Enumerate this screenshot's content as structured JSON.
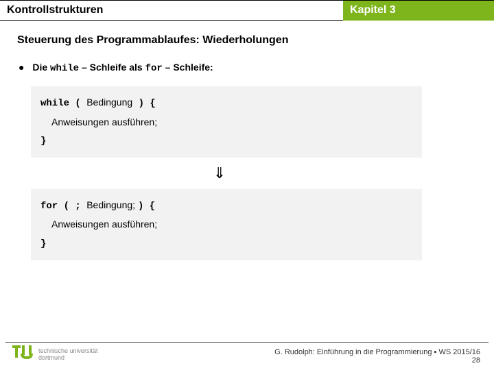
{
  "header": {
    "left": "Kontrollstrukturen",
    "right": "Kapitel 3"
  },
  "subtitle": "Steuerung des Programmablaufes: Wiederholungen",
  "bullet": {
    "pre": "Die ",
    "kw1": "while",
    "mid1": " – Schleife als ",
    "kw2": "for",
    "mid2": " – Schleife:"
  },
  "code1": {
    "l1a": "while ( ",
    "l1b": "Bedingung",
    "l1c": " ) {",
    "l2": "Anweisungen ausführen;",
    "l3": "}"
  },
  "arrow": "⇓",
  "code2": {
    "l1a": "for ( ; ",
    "l1b": "Bedingung; ",
    "l1c": ") {",
    "l2": "Anweisungen ausführen;",
    "l3": "}"
  },
  "footer": {
    "uni1": "technische universität",
    "uni2": "dortmund",
    "credit": "G. Rudolph: Einführung in die Programmierung ▪ WS 2015/16",
    "page": "28"
  }
}
